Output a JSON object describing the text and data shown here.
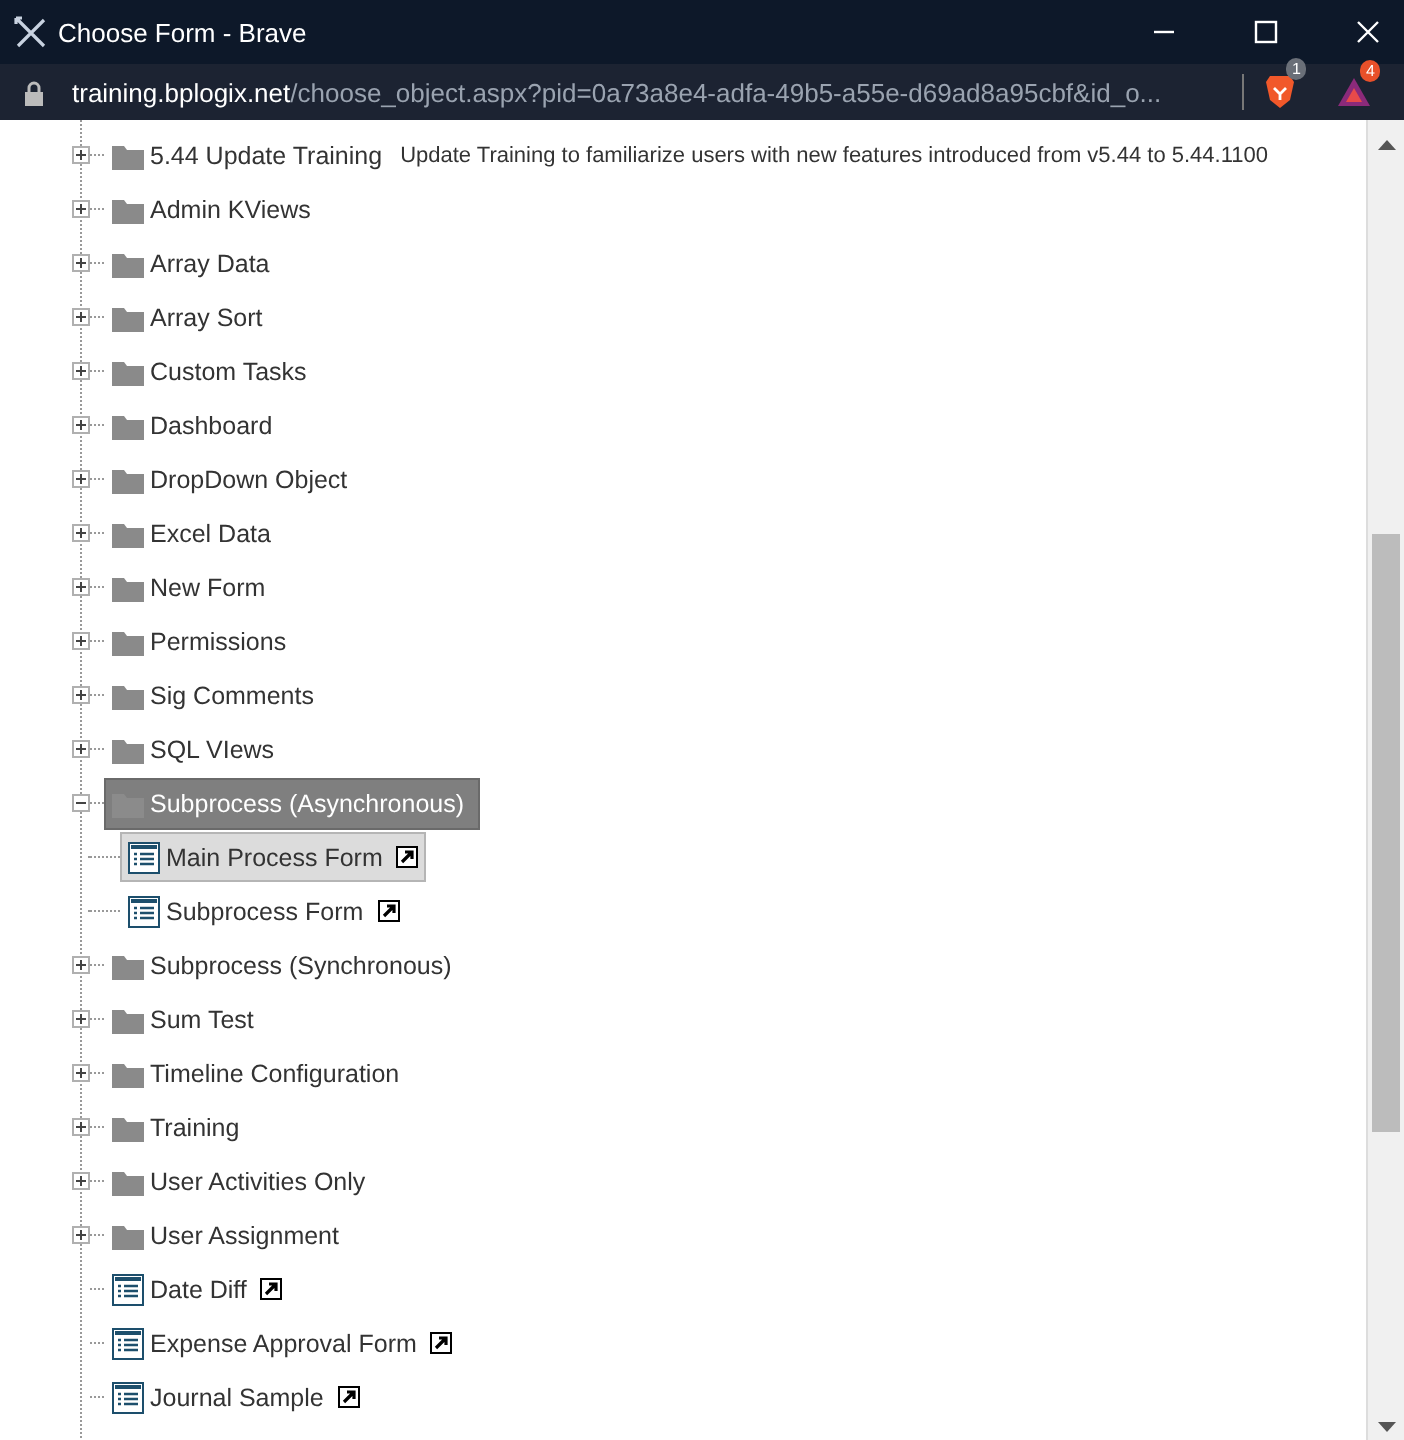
{
  "window": {
    "title": "Choose Form - Brave"
  },
  "address_bar": {
    "host": "training.bplogix.net",
    "path": "/choose_object.aspx?pid=0a73a8e4-adfa-49b5-a55e-d69ad8a95cbf&id_o...",
    "shields_badge": "1",
    "rewards_badge": "4"
  },
  "tree": [
    {
      "kind": "folder",
      "label": "5.44 Update Training",
      "description": "Update Training to familiarize users with new features introduced from v5.44 to 5.44.1100",
      "expanded": false,
      "selected": false
    },
    {
      "kind": "folder",
      "label": "Admin KViews",
      "expanded": false,
      "selected": false
    },
    {
      "kind": "folder",
      "label": "Array Data",
      "expanded": false,
      "selected": false
    },
    {
      "kind": "folder",
      "label": "Array Sort",
      "expanded": false,
      "selected": false
    },
    {
      "kind": "folder",
      "label": "Custom Tasks",
      "expanded": false,
      "selected": false
    },
    {
      "kind": "folder",
      "label": "Dashboard",
      "expanded": false,
      "selected": false
    },
    {
      "kind": "folder",
      "label": "DropDown Object",
      "expanded": false,
      "selected": false
    },
    {
      "kind": "folder",
      "label": "Excel Data",
      "expanded": false,
      "selected": false
    },
    {
      "kind": "folder",
      "label": "New Form",
      "expanded": false,
      "selected": false
    },
    {
      "kind": "folder",
      "label": "Permissions",
      "expanded": false,
      "selected": false
    },
    {
      "kind": "folder",
      "label": "Sig Comments",
      "expanded": false,
      "selected": false
    },
    {
      "kind": "folder",
      "label": "SQL VIews",
      "expanded": false,
      "selected": false
    },
    {
      "kind": "folder",
      "label": "Subprocess (Asynchronous)",
      "expanded": true,
      "selected": true,
      "children": [
        {
          "kind": "form",
          "label": "Main Process Form",
          "selected": true
        },
        {
          "kind": "form",
          "label": "Subprocess Form",
          "selected": false
        }
      ]
    },
    {
      "kind": "folder",
      "label": "Subprocess (Synchronous)",
      "expanded": false,
      "selected": false
    },
    {
      "kind": "folder",
      "label": "Sum Test",
      "expanded": false,
      "selected": false
    },
    {
      "kind": "folder",
      "label": "Timeline Configuration",
      "expanded": false,
      "selected": false
    },
    {
      "kind": "folder",
      "label": "Training",
      "expanded": false,
      "selected": false
    },
    {
      "kind": "folder",
      "label": "User Activities Only",
      "expanded": false,
      "selected": false
    },
    {
      "kind": "folder",
      "label": "User Assignment",
      "expanded": false,
      "selected": false
    },
    {
      "kind": "form",
      "label": "Date Diff",
      "selected": false
    },
    {
      "kind": "form",
      "label": "Expense Approval Form",
      "selected": false
    },
    {
      "kind": "form",
      "label": "Journal Sample",
      "selected": false
    }
  ]
}
